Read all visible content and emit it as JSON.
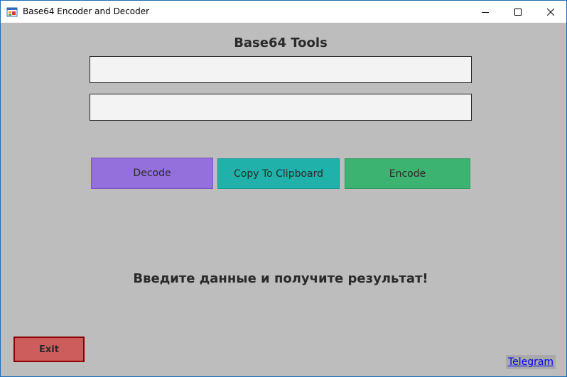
{
  "window": {
    "title": "Base64 Encoder and Decoder",
    "controls": {
      "minimize_icon": "minimize-icon",
      "maximize_icon": "maximize-icon",
      "close_icon": "close-icon"
    },
    "app_icon": "app-window-icon"
  },
  "main": {
    "heading": "Base64 Tools",
    "input_field": {
      "value": "",
      "placeholder": ""
    },
    "output_field": {
      "value": "",
      "placeholder": ""
    },
    "buttons": {
      "decode": "Decode",
      "copy": "Copy To Clipboard",
      "encode": "Encode"
    },
    "message": "Введите данные и получите результат!",
    "exit": "Exit",
    "link": "Telegram"
  },
  "colors": {
    "background": "#bdbdbd",
    "decode": "#9370db",
    "copy": "#20b2aa",
    "encode": "#3cb371",
    "exit": "#cd5c5c",
    "exit_border": "#8b0000",
    "link": "#0000ee"
  }
}
